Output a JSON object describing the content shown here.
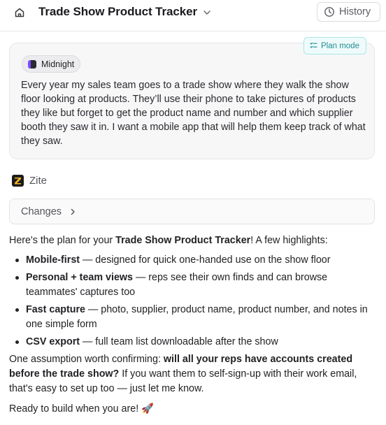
{
  "header": {
    "title": "Trade Show Product Tracker",
    "history_label": "History"
  },
  "user_message": {
    "plan_badge": "Plan mode",
    "theme": "Midnight",
    "text": "Every year my sales team goes to a trade show where they walk the show floor looking at products. They’ll use their phone to take pictures of products they like but forget to get the product name and number and which supplier booth they saw it in. I want a mobile app that will help them keep track of what they saw."
  },
  "assistant": {
    "name": "Zite",
    "changes_label": "Changes",
    "intro_pre": "Here's the plan for your ",
    "intro_bold": "Trade Show Product Tracker",
    "intro_post": "! A few highlights:",
    "bullets": [
      {
        "bold": "Mobile-first",
        "text": " — designed for quick one-handed use on the show floor"
      },
      {
        "bold": "Personal + team views",
        "text": " — reps see their own finds and can browse teammates' captures too"
      },
      {
        "bold": "Fast capture",
        "text": " — photo, supplier, product name, product number, and notes in one simple form"
      },
      {
        "bold": "CSV export",
        "text": " — full team list downloadable after the show"
      }
    ],
    "assume_pre": "One assumption worth confirming: ",
    "assume_bold": "will all your reps have accounts created before the trade show?",
    "assume_post": " If you want them to self-sign-up with their work email, that's easy to set up too — just let me know.",
    "ready": "Ready to build when you are! 🚀"
  },
  "icons": {
    "home": "home-icon",
    "chevron": "chevron-down-icon",
    "history": "clock-icon",
    "plan": "checklist-icon",
    "changes_chevron": "chevron-right-icon"
  }
}
